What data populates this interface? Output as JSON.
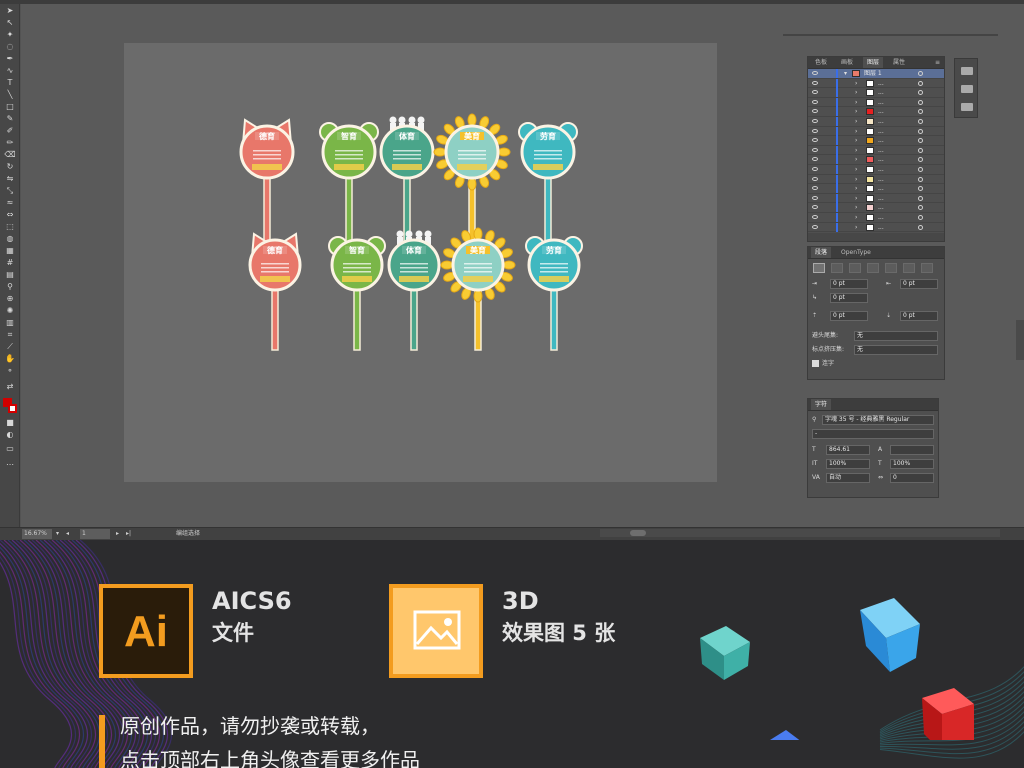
{
  "layers_panel": {
    "tabs": [
      "色板",
      "画板",
      "图层",
      "属性"
    ],
    "active_tab": "图层",
    "rows": [
      {
        "name": "图层 1",
        "swatch": "#e87b6a",
        "expanded": true
      },
      {
        "name": "...",
        "swatch": "#ffffff"
      },
      {
        "name": "...",
        "swatch": "#ffffff"
      },
      {
        "name": "...",
        "swatch": "#ffffff"
      },
      {
        "name": "...",
        "swatch": "#e82020"
      },
      {
        "name": "...",
        "swatch": "#f4e4c4"
      },
      {
        "name": "...",
        "swatch": "#ffffff"
      },
      {
        "name": "...",
        "swatch": "#f2a81c"
      },
      {
        "name": "...",
        "swatch": "#ffffff"
      },
      {
        "name": "...",
        "swatch": "#f25c5c"
      },
      {
        "name": "...",
        "swatch": "#ffffff"
      },
      {
        "name": "...",
        "swatch": "#f5e6a0"
      },
      {
        "name": "...",
        "swatch": "#ffffff"
      },
      {
        "name": "...",
        "swatch": "#ffffff"
      },
      {
        "name": "...",
        "swatch": "#f4d0d0"
      },
      {
        "name": "...",
        "swatch": "#ffffff"
      },
      {
        "name": "...",
        "swatch": "#ffffff"
      }
    ]
  },
  "paragraph_panel": {
    "tabs": [
      "段落",
      "OpenType"
    ],
    "indent_left": "0 pt",
    "indent_right": "0 pt",
    "indent_first": "0 pt",
    "space_before": "0 pt",
    "space_after": "0 pt",
    "kinsoku_label": "避头尾集:",
    "kinsoku_value": "无",
    "mojikumi_label": "标点挤压集:",
    "mojikumi_value": "无",
    "hyphenate_label": "连字"
  },
  "character_panel": {
    "title": "字符",
    "font": "字魂 35 号 - 经典雅黑 Regular",
    "font_style": "-",
    "size": "864.61",
    "leading": "",
    "vscale": "100%",
    "hscale": "100%",
    "kerning": "自动",
    "tracking": "0"
  },
  "status_bar": {
    "zoom": "16.67%",
    "page": "1",
    "tool": "编组选择"
  },
  "signs": [
    {
      "label": "德育",
      "color": "#e8776a",
      "ears": "cat"
    },
    {
      "label": "智育",
      "color": "#7ab648",
      "ears": "round"
    },
    {
      "label": "体育",
      "color": "#4aa58a",
      "ears": "people"
    },
    {
      "label": "美育",
      "color": "#f5c12c",
      "ears": "flower"
    },
    {
      "label": "劳育",
      "color": "#3fb8c0",
      "ears": "round"
    }
  ],
  "promo": {
    "ai_badge_text": "Ai",
    "ai_title": "AICS6",
    "ai_sub": "文件",
    "img_title": "3D",
    "img_sub": "效果图 5 张",
    "note_line1": "原创作品，请勿抄袭或转载，",
    "note_line2": "点击顶部右上角头像查看更多作品"
  },
  "colors": {
    "accent": "#f39c1f",
    "workspace": "#535353",
    "artboard": "#6b6b6b",
    "layer_highlight": "#5b6f97"
  }
}
